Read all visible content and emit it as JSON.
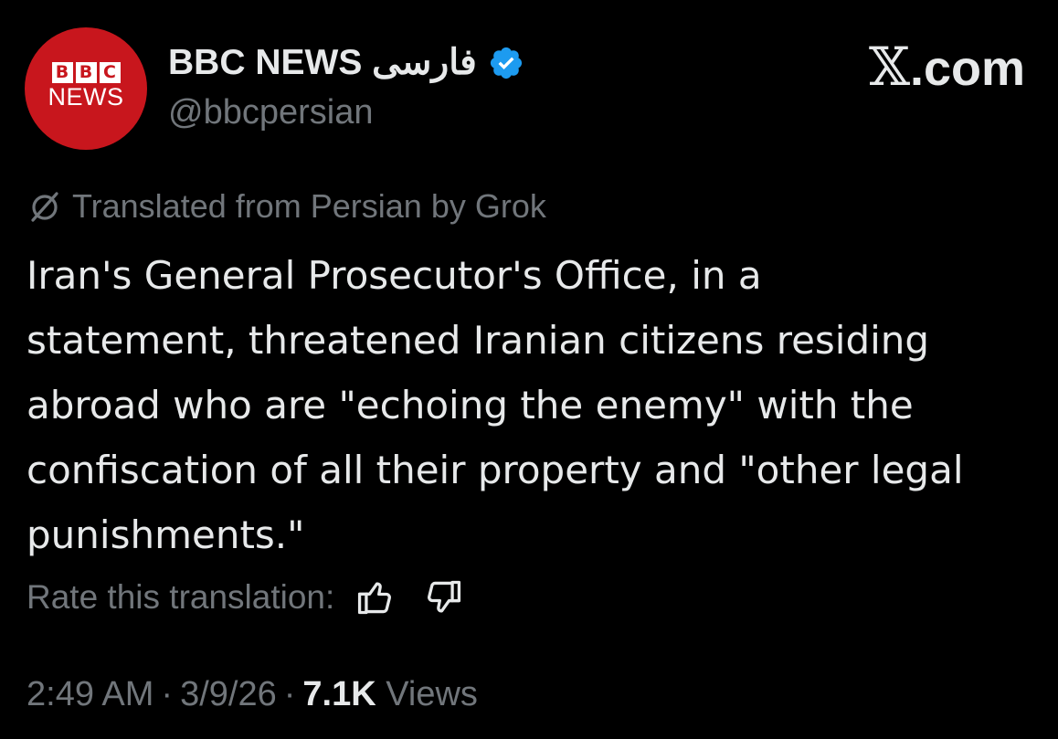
{
  "tweet": {
    "avatar": {
      "letters": [
        "B",
        "B",
        "C"
      ],
      "word": "NEWS",
      "color": "#c8161d"
    },
    "display_name": "BBC NEWS فارسی",
    "verified_icon": "verified-badge-icon",
    "handle": "@bbcpersian",
    "site": {
      "x_glyph": "𝕏",
      "suffix": ".com"
    },
    "translation_note": "Translated from Persian by Grok",
    "translation_icon": "grok-icon",
    "body_lines": [
      "Iran's General Prosecutor's Office, in a",
      "statement, threatened Iranian citizens residing",
      "abroad who are \"echoing the enemy\" with the",
      "confiscation of all their property and \"other legal",
      "punishments.\""
    ],
    "rate_label": "Rate this translation:",
    "rate_icons": [
      "thumbs-up-icon",
      "thumbs-down-icon"
    ],
    "meta": {
      "time": "2:49 AM",
      "date": "3/9/26",
      "separator": "·",
      "views_count": "7.1K",
      "views_label": "Views"
    }
  },
  "colors": {
    "background": "#000000",
    "primary_text": "#e7e9ea",
    "secondary_text": "#71767b",
    "verified": "#1d9bf0",
    "brand_red": "#c8161d"
  }
}
